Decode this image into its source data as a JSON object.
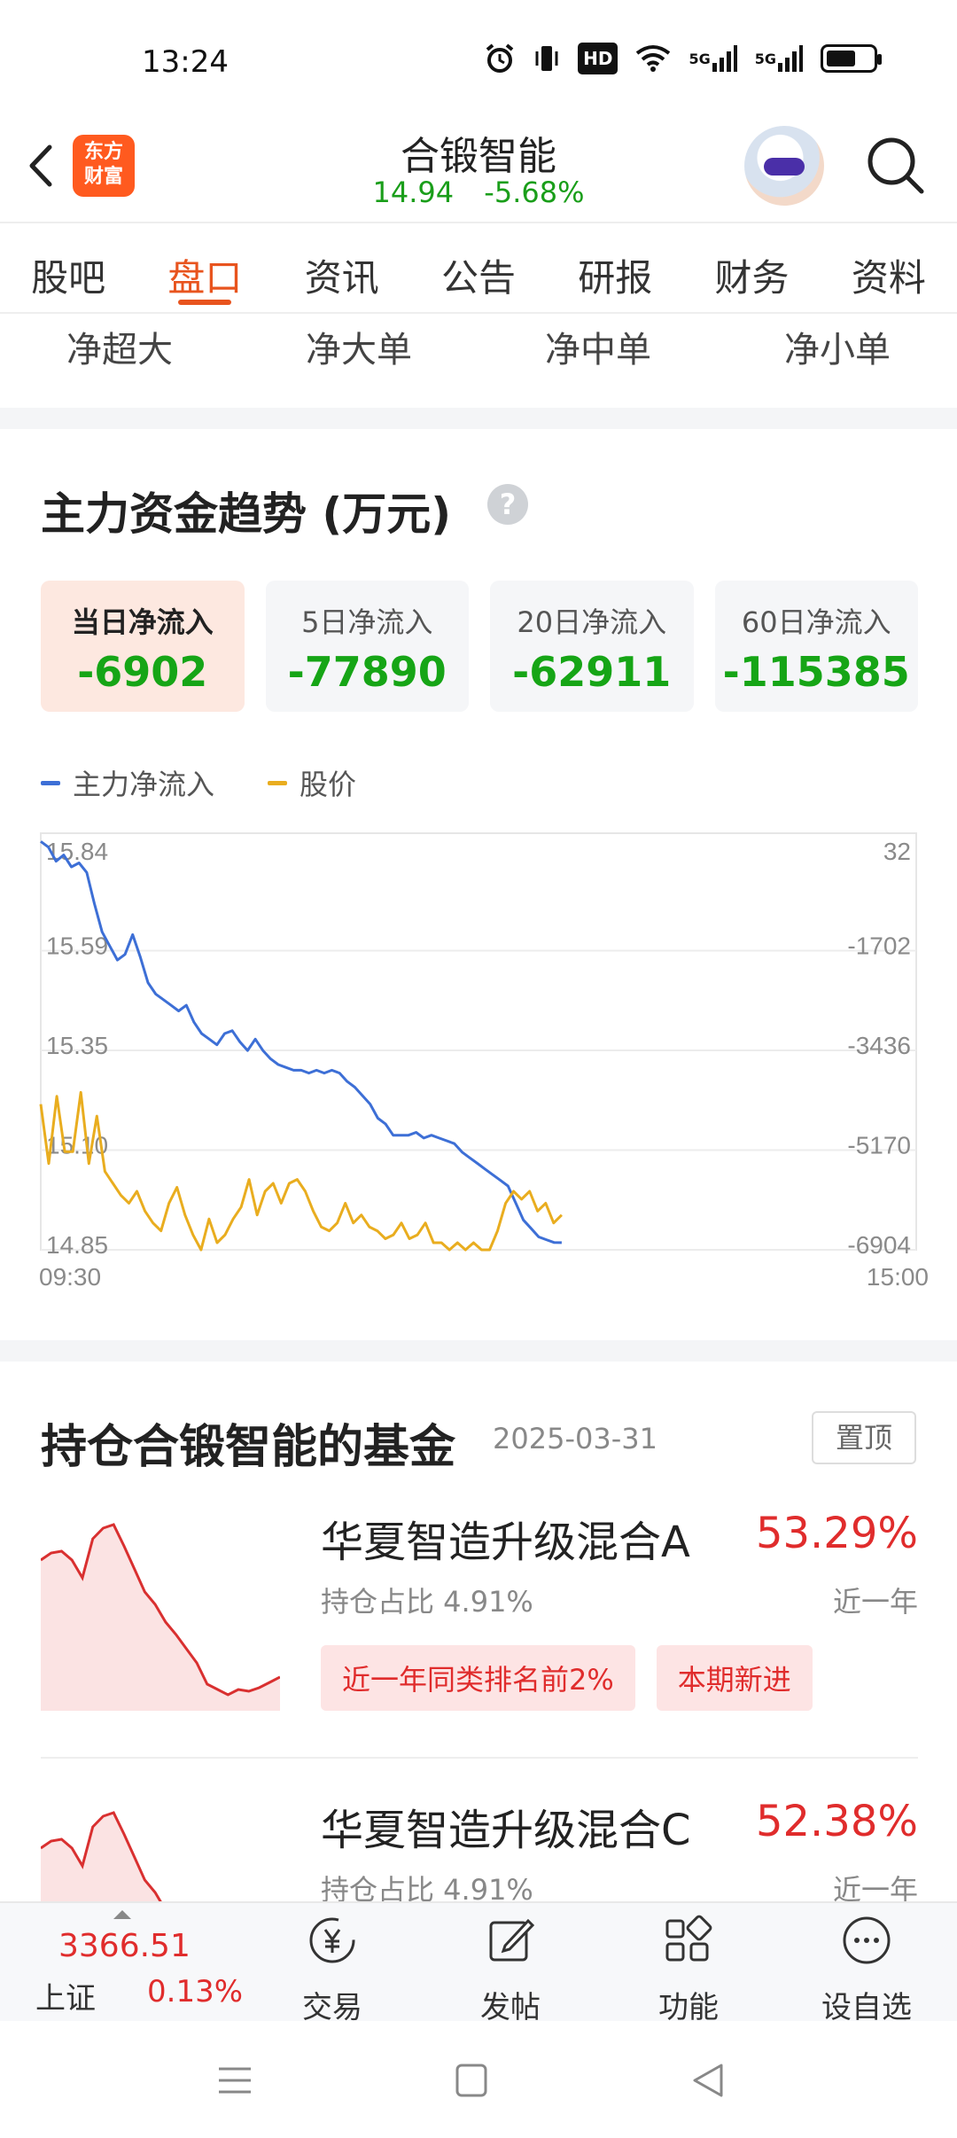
{
  "status": {
    "time": "13:24",
    "icons": [
      "alarm-icon",
      "vibrate-icon",
      "hd-icon",
      "wifi-icon",
      "5g-signal-icon",
      "5g-signal-icon",
      "battery-icon"
    ],
    "hd_text": "HD",
    "net1": "5G",
    "net2": "5G"
  },
  "header": {
    "logo_line1": "东方",
    "logo_line2": "财富",
    "title": "合锻智能",
    "price": "14.94",
    "change": "-5.68%"
  },
  "tabs": [
    "股吧",
    "盘口",
    "资讯",
    "公告",
    "研报",
    "财务",
    "资料"
  ],
  "active_tab": "盘口",
  "subtabs": [
    "净超大",
    "净大单",
    "净中单",
    "净小单"
  ],
  "trend": {
    "title": "主力资金趋势 (万元)",
    "help": "?",
    "cards": [
      {
        "label": "当日净流入",
        "value": "-6902"
      },
      {
        "label": "5日净流入",
        "value": "-77890"
      },
      {
        "label": "20日净流入",
        "value": "-62911"
      },
      {
        "label": "60日净流入",
        "value": "-115385"
      }
    ],
    "legend": [
      {
        "name": "主力净流入",
        "color": "#3d6fd6"
      },
      {
        "name": "股价",
        "color": "#e9ad1f"
      }
    ]
  },
  "chart_data": {
    "type": "line",
    "left_axis_ticks": [
      "15.84",
      "15.59",
      "15.35",
      "15.10",
      "14.85"
    ],
    "right_axis_ticks": [
      "32",
      "-1702",
      "-3436",
      "-5170",
      "-6904"
    ],
    "x_labels": [
      "09:30",
      "15:00"
    ],
    "price_range": [
      14.85,
      15.84
    ],
    "flow_range": [
      -6904,
      32
    ],
    "grid": true,
    "series": [
      {
        "name": "主力净流入",
        "axis": "right",
        "color": "#3d6fd6",
        "values": [
          200,
          100,
          -150,
          -40,
          -250,
          -180,
          -350,
          -900,
          -1400,
          -1650,
          -1900,
          -1800,
          -1450,
          -1850,
          -2300,
          -2500,
          -2600,
          -2700,
          -2800,
          -2700,
          -3000,
          -3200,
          -3300,
          -3400,
          -3200,
          -3150,
          -3350,
          -3500,
          -3300,
          -3500,
          -3650,
          -3750,
          -3800,
          -3850,
          -3850,
          -3900,
          -3850,
          -3900,
          -3850,
          -3900,
          -4050,
          -4150,
          -4300,
          -4450,
          -4700,
          -4800,
          -5000,
          -5000,
          -5000,
          -4950,
          -5050,
          -5000,
          -5050,
          -5100,
          -5150,
          -5300,
          -5400,
          -5500,
          -5600,
          -5700,
          -5800,
          -5900,
          -6200,
          -6500,
          -6650,
          -6800,
          -6850,
          -6900,
          -6902
        ]
      },
      {
        "name": "股价",
        "axis": "left",
        "color": "#e9ad1f",
        "values": [
          15.2,
          15.05,
          15.22,
          15.08,
          15.08,
          15.23,
          15.05,
          15.17,
          15.03,
          15.0,
          14.97,
          14.95,
          14.98,
          14.93,
          14.9,
          14.88,
          14.95,
          14.99,
          14.92,
          14.87,
          14.8,
          14.91,
          14.85,
          14.87,
          14.91,
          14.94,
          15.01,
          14.92,
          14.98,
          15.0,
          14.95,
          15.0,
          15.01,
          14.98,
          14.93,
          14.89,
          14.88,
          14.9,
          14.95,
          14.9,
          14.92,
          14.89,
          14.88,
          14.86,
          14.87,
          14.9,
          14.86,
          14.87,
          14.9,
          14.85,
          14.85,
          14.82,
          14.85,
          14.83,
          14.85,
          14.8,
          14.82,
          14.88,
          14.95,
          14.98,
          14.96,
          14.98,
          14.93,
          14.95,
          14.9,
          14.92
        ]
      }
    ]
  },
  "funds": {
    "title": "持仓合锻智能的基金",
    "date": "2025-03-31",
    "pin": "置顶",
    "items": [
      {
        "name": "华夏智造升级混合A",
        "return": "53.29%",
        "hold": "持仓占比  4.91%",
        "period": "近一年",
        "tags": [
          "近一年同类排名前2%",
          "本期新进"
        ],
        "spark": [
          0.86,
          0.89,
          0.92,
          0.94,
          0.93,
          0.96,
          0.93,
          0.9,
          0.78,
          0.7,
          0.62,
          0.55,
          0.45,
          0.38,
          0.25,
          0.12,
          0.0,
          0.02,
          0.08,
          0.3,
          0.2,
          0.15,
          0.16,
          0.2
        ]
      },
      {
        "name": "华夏智造升级混合C",
        "return": "52.38%",
        "hold": "持仓占比  4.91%",
        "period": "近一年",
        "tags": [],
        "spark": [
          0.86,
          0.89,
          0.92,
          0.94,
          0.93,
          0.96,
          0.93,
          0.9,
          0.78,
          0.7,
          0.62,
          0.55,
          0.45,
          0.38,
          0.25,
          0.12,
          0.0,
          0.02,
          0.08,
          0.3,
          0.2,
          0.15,
          0.16,
          0.2
        ]
      }
    ]
  },
  "bottom": {
    "index_value": "3366.51",
    "index_name": "上证",
    "index_pct": "0.13%",
    "items": [
      {
        "label": "交易",
        "icon": "yen-trade-icon"
      },
      {
        "label": "发帖",
        "icon": "edit-post-icon"
      },
      {
        "label": "功能",
        "icon": "grid-apps-icon"
      },
      {
        "label": "设自选",
        "icon": "more-icon"
      }
    ]
  }
}
